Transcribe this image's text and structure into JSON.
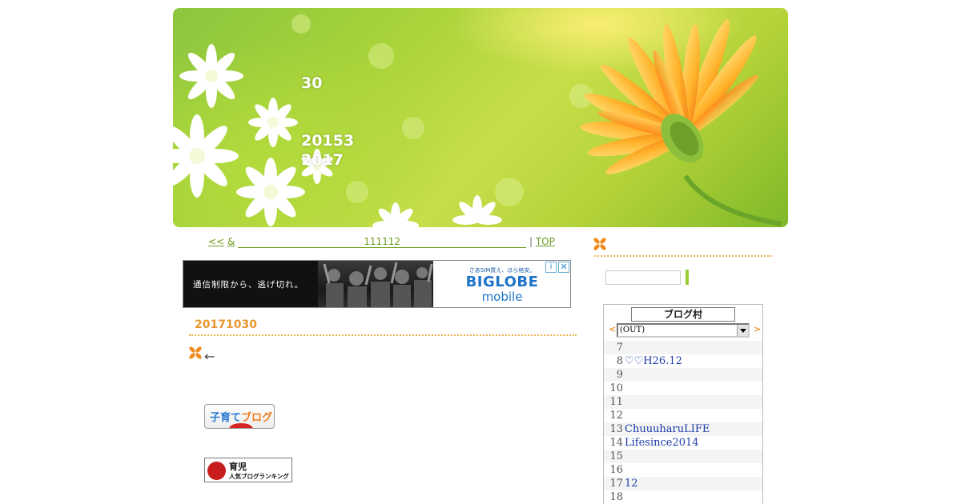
{
  "header": {
    "line1": "30",
    "line2": "20153",
    "line3": "2017"
  },
  "nav": {
    "prev": "<<",
    "amp": "&",
    "title": "111112",
    "sep": "|",
    "top": "TOP"
  },
  "ad": {
    "left_text": "通信制限から、逃げ切れ。",
    "small_text": "さあSIM買え、ほら格安。",
    "brand": "BIGLOBE",
    "sub": "mobile",
    "info": "i",
    "close": "✕"
  },
  "post": {
    "date": "20171030",
    "arrow": "←"
  },
  "banners": {
    "kosodate_a": "子育て",
    "kosodate_b": "ブログ",
    "ikuji_1": "育児",
    "ikuji_2": "人気ブログランキング"
  },
  "ranking": {
    "logo": "ブログ村",
    "prev": "<",
    "next": ">",
    "selected": "(OUT)",
    "rows": [
      {
        "num": "7",
        "name": ""
      },
      {
        "num": "8",
        "name": "♡♡H26.12"
      },
      {
        "num": "9",
        "name": ""
      },
      {
        "num": "10",
        "name": ""
      },
      {
        "num": "11",
        "name": ""
      },
      {
        "num": "12",
        "name": ""
      },
      {
        "num": "13",
        "name": "ChuuuharuLIFE"
      },
      {
        "num": "14",
        "name": "Lifesince2014"
      },
      {
        "num": "15",
        "name": ""
      },
      {
        "num": "16",
        "name": ""
      },
      {
        "num": "17",
        "name": "12"
      },
      {
        "num": "18",
        "name": ""
      }
    ]
  },
  "colors": {
    "accent_orange": "#e8962d",
    "link_green": "#6a9a1f",
    "rank_link": "#1a3aa8"
  }
}
